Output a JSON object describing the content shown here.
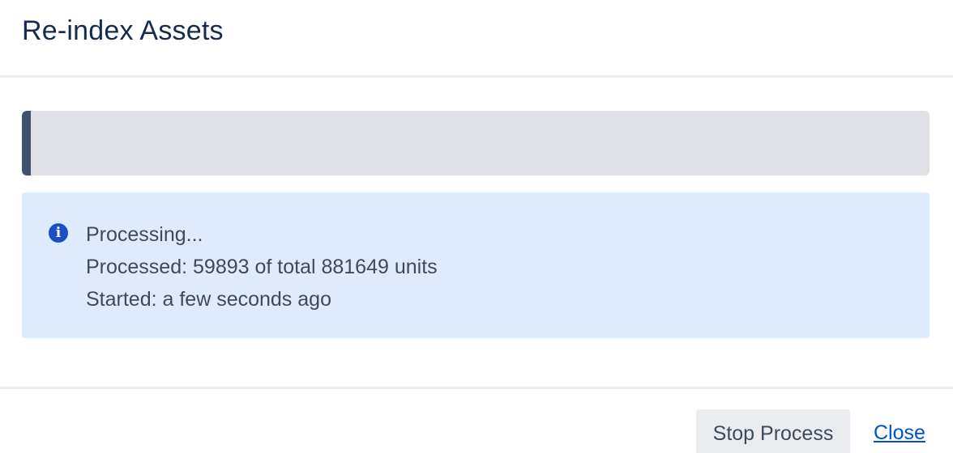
{
  "dialog": {
    "title": "Re-index Assets"
  },
  "progress": {
    "processed": 59893,
    "total": 881649,
    "fraction": 0.0679
  },
  "info": {
    "icon": "info-icon",
    "icon_glyph": "i",
    "status_line": "Processing...",
    "processed_line": "Processed: 59893 of total 881649 units",
    "started_line": "Started: a few seconds ago"
  },
  "footer": {
    "stop_label": "Stop Process",
    "close_label": "Close"
  },
  "colors": {
    "progress_fill": "#42526e",
    "progress_track": "#dfe1e6",
    "info_background": "#deebff",
    "info_icon": "#1d4fc4",
    "link": "#0052cc"
  }
}
